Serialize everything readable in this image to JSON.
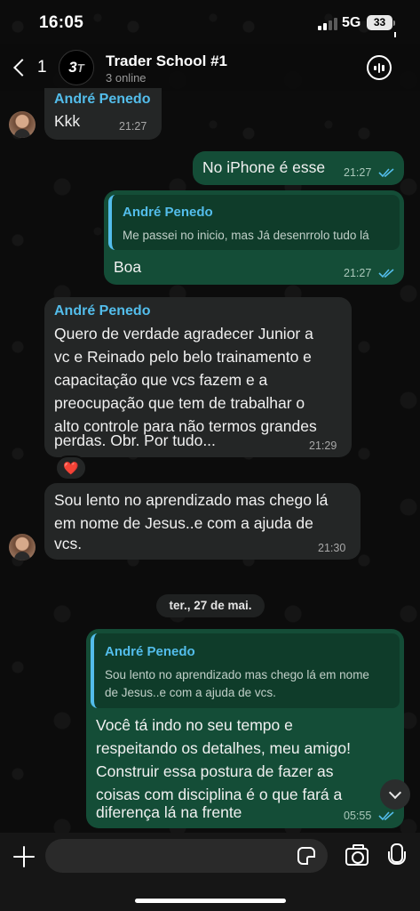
{
  "status_bar": {
    "time": "16:05",
    "network": "5G",
    "battery": "33"
  },
  "header": {
    "back_count": "1",
    "group_title": "Trader School #1",
    "subtitle": "3 online"
  },
  "messages": [
    {
      "sender": "André Penedo",
      "text": "Kkk",
      "time": "21:27"
    },
    {
      "text": "No iPhone é esse",
      "time": "21:27"
    },
    {
      "quote_sender": "André Penedo",
      "quote_text": "Me passei no inicio, mas Já desenrrolo tudo lá",
      "text": "Boa",
      "time": "21:27"
    },
    {
      "sender": "André Penedo",
      "lines": [
        "Quero de verdade agradecer Junior a",
        "vc e Reinado pelo belo trainamento e",
        "capacitação que vcs fazem e a",
        "preocupação que tem de trabalhar o",
        "alto controle para não termos grandes",
        "perdas. Obr. Por tudo..."
      ],
      "time": "21:29",
      "reaction": "❤️"
    },
    {
      "lines": [
        "Sou lento no aprendizado mas chego lá",
        "em nome de Jesus..e com a ajuda de",
        "vcs."
      ],
      "time": "21:30"
    },
    {
      "quote_sender": "André Penedo",
      "quote_lines": [
        "Sou lento no aprendizado mas chego lá em nome",
        "de Jesus..e com a ajuda de vcs."
      ],
      "lines": [
        "Você tá indo no seu tempo e",
        "respeitando os detalhes, meu amigo!",
        "Construir essa postura de fazer as",
        "coisas com disciplina é o que fará a",
        "diferença lá na frente"
      ],
      "time": "05:55"
    }
  ],
  "date_separator": "ter., 27 de mai.",
  "composer": {
    "placeholder": ""
  },
  "icons": [
    "back-chevron-icon",
    "voice-chat-icon",
    "plus-icon",
    "sticker-icon",
    "camera-icon",
    "mic-icon",
    "heart-icon",
    "double-check-icon",
    "chevron-down-icon"
  ],
  "colors": {
    "incoming_bubble": "#242626",
    "outgoing_bubble": "#144d37",
    "sender_name": "#53bdeb",
    "read_ticks": "#53bdeb"
  }
}
